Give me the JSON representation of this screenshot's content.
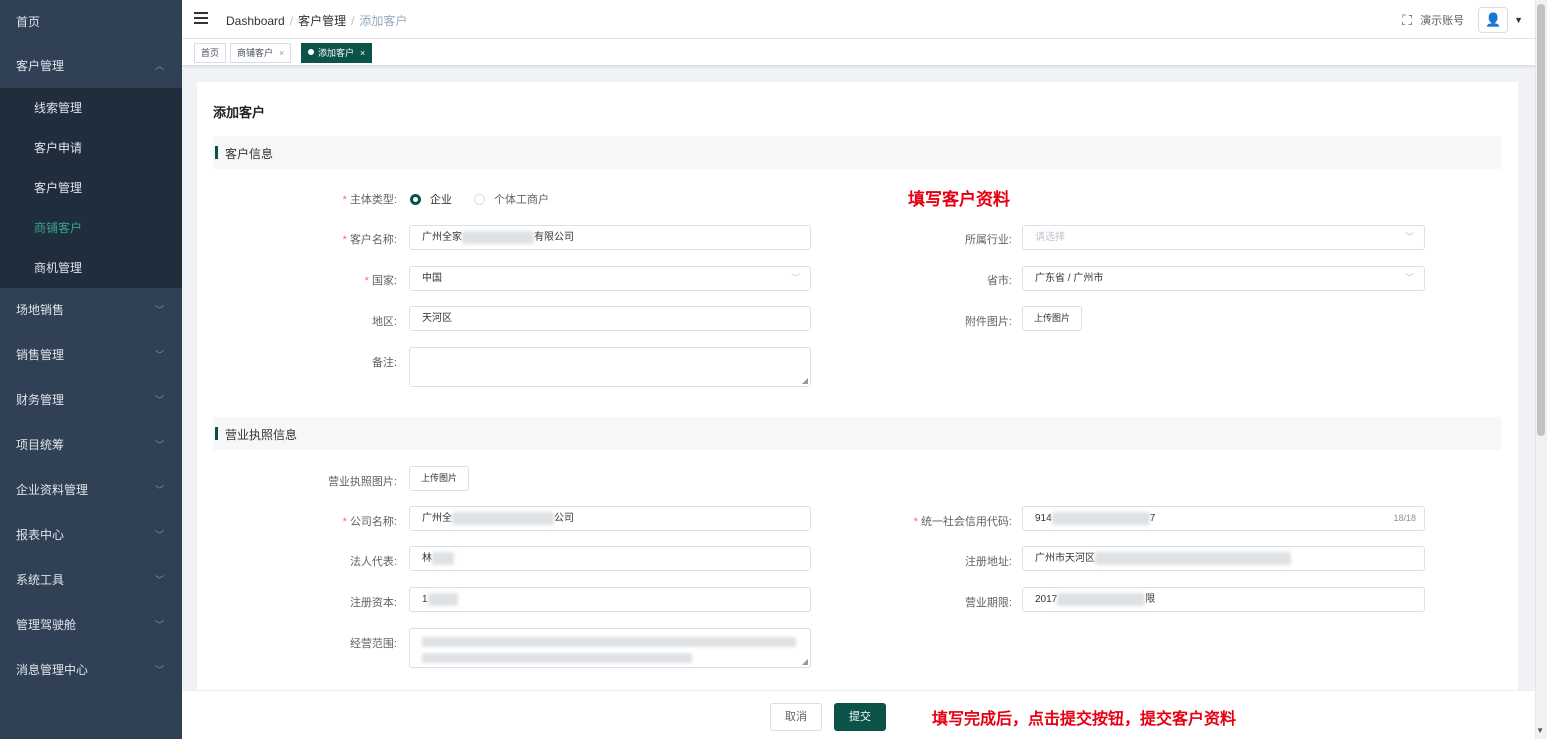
{
  "sidebar": {
    "home": "首页",
    "customer_mgmt": "客户管理",
    "sub_items": [
      "线索管理",
      "客户申请",
      "客户管理",
      "商铺客户",
      "商机管理"
    ],
    "groups": [
      "场地销售",
      "销售管理",
      "财务管理",
      "项目统筹",
      "企业资料管理",
      "报表中心",
      "系统工具",
      "管理驾驶舱",
      "消息管理中心"
    ]
  },
  "navbar": {
    "breadcrumb": [
      "Dashboard",
      "客户管理",
      "添加客户"
    ],
    "account_name": "演示账号"
  },
  "tags": [
    "首页",
    "商铺客户",
    "添加客户"
  ],
  "page_title": "添加客户",
  "section_customer": "客户信息",
  "section_license": "营业执照信息",
  "annotation_top": "填写客户资料",
  "annotation_bottom": "填写完成后，点击提交按钮，提交客户资料",
  "form": {
    "entity_type_label": "主体类型:",
    "entity_type_options": [
      "企业",
      "个体工商户"
    ],
    "customer_name_label": "客户名称:",
    "customer_name_prefix": "广州全家",
    "customer_name_suffix": "有限公司",
    "industry_label": "所属行业:",
    "industry_placeholder": "请选择",
    "country_label": "国家:",
    "country_value": "中国",
    "province_label": "省市:",
    "province_value": "广东省 / 广州市",
    "district_label": "地区:",
    "district_value": "天河区",
    "attachment_label": "附件图片:",
    "upload_label": "上传图片",
    "remark_label": "备注:",
    "license_image_label": "营业执照图片:",
    "company_name_label": "公司名称:",
    "company_name_prefix": "广州全",
    "company_name_suffix": "公司",
    "credit_code_label": "统一社会信用代码:",
    "credit_code_prefix": "914",
    "credit_code_suffix": "7",
    "credit_code_counter": "18/18",
    "legal_rep_label": "法人代表:",
    "legal_rep_prefix": "林",
    "reg_address_label": "注册地址:",
    "reg_address_prefix": "广州市天河区",
    "reg_capital_label": "注册资本:",
    "reg_capital_prefix": "1",
    "business_term_label": "营业期限:",
    "business_term_prefix": "2017",
    "business_term_suffix": "限",
    "business_scope_label": "经营范围:"
  },
  "footer": {
    "cancel": "取消",
    "submit": "提交"
  }
}
